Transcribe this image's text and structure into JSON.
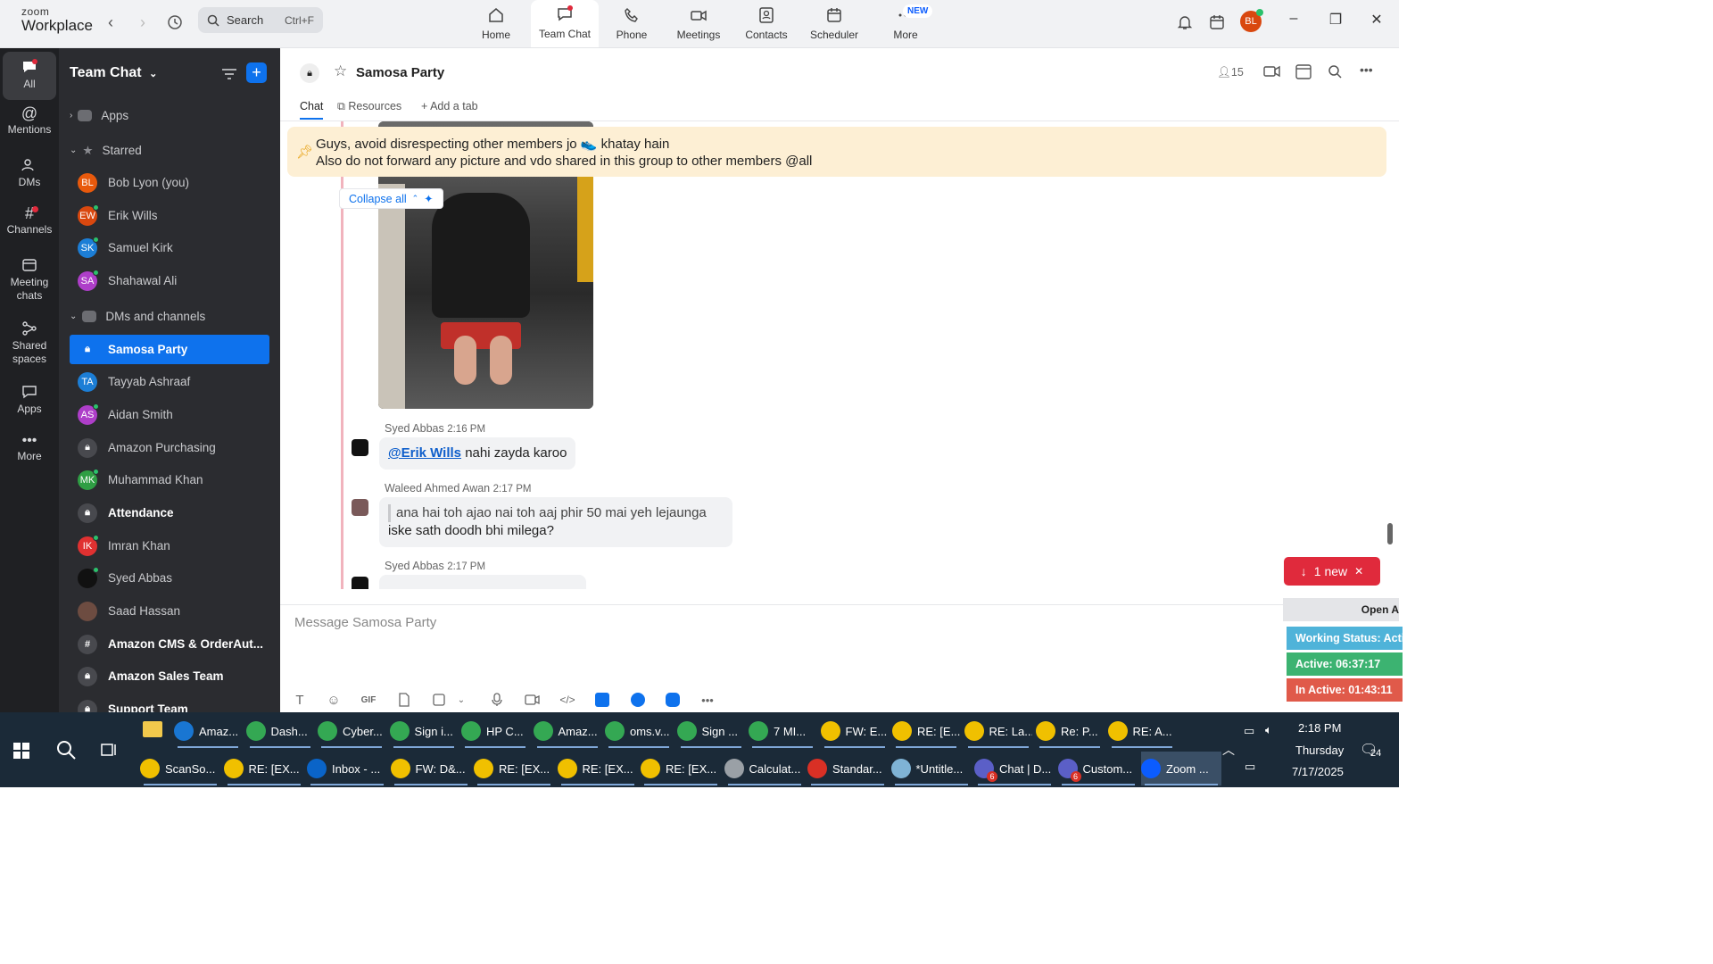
{
  "app": {
    "logo_top": "zoom",
    "logo_bottom": "Workplace"
  },
  "search": {
    "label": "Search",
    "shortcut": "Ctrl+F"
  },
  "top_tabs": [
    {
      "label": "Home",
      "icon": "home-icon"
    },
    {
      "label": "Team Chat",
      "icon": "chat-icon",
      "active": true
    },
    {
      "label": "Phone",
      "icon": "phone-icon"
    },
    {
      "label": "Meetings",
      "icon": "video-icon"
    },
    {
      "label": "Contacts",
      "icon": "contacts-icon"
    },
    {
      "label": "Scheduler",
      "icon": "calendar-icon"
    },
    {
      "label": "More",
      "icon": "more-icon"
    }
  ],
  "new_badge": "NEW",
  "profile_initials": "BL",
  "rail": [
    {
      "label": "All",
      "active": true
    },
    {
      "label": "Mentions"
    },
    {
      "label": "DMs"
    },
    {
      "label": "Channels"
    },
    {
      "label": "Meeting chats"
    },
    {
      "label": "Shared spaces"
    },
    {
      "label": "Apps"
    },
    {
      "label": "More"
    }
  ],
  "sidebar": {
    "title": "Team Chat",
    "sections": {
      "apps": "Apps",
      "starred": "Starred",
      "dms": "DMs and channels"
    },
    "starred": [
      {
        "initials": "BL",
        "name": "Bob Lyon (you)",
        "color": "#e8590c"
      },
      {
        "initials": "EW",
        "name": "Erik Wills",
        "color": "#d9480f"
      },
      {
        "initials": "SK",
        "name": "Samuel Kirk",
        "color": "#1c7ed6"
      },
      {
        "initials": "SA",
        "name": "Shahawal Ali",
        "color": "#ae3ec9"
      }
    ],
    "channels": [
      {
        "initials": "",
        "name": "Samosa Party",
        "type": "lock",
        "selected": true
      },
      {
        "initials": "TA",
        "name": "Tayyab Ashraaf",
        "color": "#1c7ed6"
      },
      {
        "initials": "AS",
        "name": "Aidan Smith",
        "color": "#ae3ec9"
      },
      {
        "initials": "",
        "name": "Amazon Purchasing",
        "type": "lock"
      },
      {
        "initials": "MK",
        "name": "Muhammad Khan",
        "color": "#2f9e44"
      },
      {
        "initials": "",
        "name": "Attendance",
        "type": "lock",
        "bold": true
      },
      {
        "initials": "IK",
        "name": "Imran Khan",
        "color": "#e03131"
      },
      {
        "initials": "",
        "name": "Syed Abbas",
        "type": "photo"
      },
      {
        "initials": "",
        "name": "Saad Hassan",
        "type": "photo"
      },
      {
        "initials": "#",
        "name": "Amazon CMS & OrderAut...",
        "type": "hash",
        "bold": true
      },
      {
        "initials": "",
        "name": "Amazon Sales Team",
        "type": "lock",
        "bold": true
      },
      {
        "initials": "",
        "name": "Support Team",
        "type": "lock",
        "bold": true
      }
    ]
  },
  "channel": {
    "name": "Samosa Party",
    "member_count": "15",
    "tabs": [
      "Chat",
      "Resources",
      "Add a tab"
    ]
  },
  "pinned": {
    "line1": "Guys, avoid disrespecting other members jo 👟 khatay hain",
    "line2": "Also do not forward any picture and vdo shared in this group to other members @all"
  },
  "collapse_label": "Collapse all",
  "messages": [
    {
      "sender": "Syed Abbas",
      "time": "2:16 PM",
      "mention": "@Erik Wills",
      "text": " nahi zayda karoo"
    },
    {
      "sender": "Waleed Ahmed Awan",
      "time": "2:17 PM",
      "quote": "ana hai toh ajao nai toh aaj phir 50 mai yeh lejaunga",
      "text": "iske sath doodh bhi milega?"
    },
    {
      "sender": "Syed Abbas",
      "time": "2:17 PM"
    }
  ],
  "new_message": {
    "label": "1 new"
  },
  "composer": {
    "placeholder": "Message Samosa Party"
  },
  "status_widget": {
    "header": "Open A",
    "working": "Working Status: Acti",
    "active": "Active: 06:37:17",
    "inactive": "In Active: 01:43:11",
    "colors": {
      "working": "#4fb3d9",
      "active": "#3cb371",
      "inactive": "#e05a4a"
    }
  },
  "taskbar": {
    "row1": [
      "Amaz...",
      "Dash...",
      "Cyber...",
      "Sign i...",
      "HP C...",
      "Amaz...",
      "oms.v...",
      "Sign ...",
      "7 MI...",
      "FW: E...",
      "RE: [E...",
      "RE: La...",
      "Re: P...",
      "RE: A..."
    ],
    "row2": [
      "ScanSo...",
      "RE: [EX...",
      "Inbox - ...",
      "FW: D&...",
      "RE: [EX...",
      "RE: [EX...",
      "RE: [EX...",
      "Calculat...",
      "Standar...",
      "*Untitle...",
      "Chat | D...",
      "Custom...",
      "Zoom ..."
    ],
    "time": "2:18 PM",
    "day": "Thursday",
    "date": "7/17/2025",
    "notif_count": "24",
    "badge_count": "6"
  }
}
